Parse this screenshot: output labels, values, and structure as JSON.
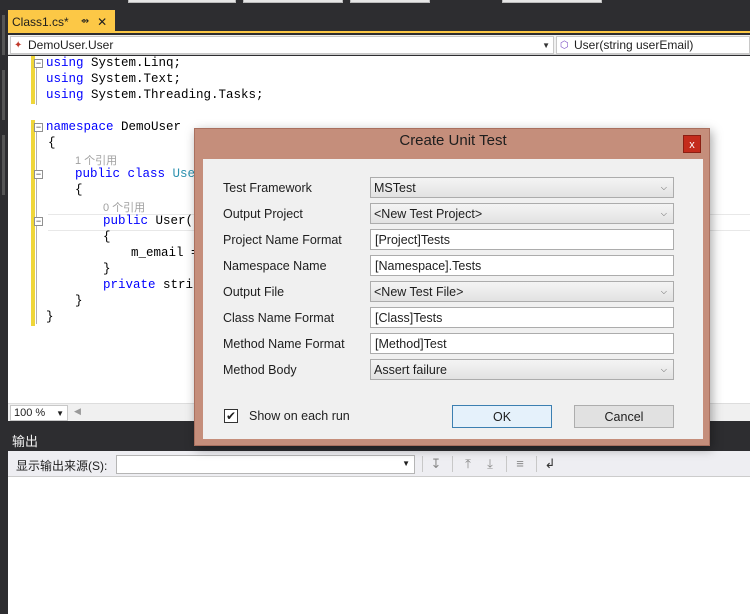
{
  "document_tab": {
    "title": "Class1.cs*",
    "pin_icon": "pin-icon",
    "close_icon": "close-icon"
  },
  "nav_bar": {
    "type_combo": "DemoUser.User",
    "member_combo": "User(string userEmail)"
  },
  "code": {
    "l1_kw": "using",
    "l1_rest": " System.Linq;",
    "l2_kw": "using",
    "l2_rest": " System.Text;",
    "l3_kw": "using",
    "l3_rest": " System.Threading.Tasks;",
    "l5_kw": "namespace",
    "l5_rest": " DemoUser",
    "l6": "{",
    "lens1": "1 个引用",
    "l7_kw": "public class",
    "l7_type": "User",
    "l8": "{",
    "lens2": "0 个引用",
    "l9_kw": "public",
    "l9_rest": " User(s",
    "l10": "{",
    "l11": "m_email =",
    "l12": "}",
    "l13_kw": "private",
    "l13_rest": " strin",
    "l14": "}",
    "l15": "}"
  },
  "zoom": {
    "value": "100 %"
  },
  "output_pane": {
    "title": "输出",
    "source_label": "显示输出来源(S):",
    "source_value": ""
  },
  "dialog": {
    "title": "Create Unit Test",
    "close_label": "x",
    "fields": {
      "test_framework": {
        "label": "Test Framework",
        "value": "MSTest"
      },
      "output_project": {
        "label": "Output Project",
        "value": "<New Test Project>"
      },
      "project_name_format": {
        "label": "Project Name Format",
        "value": "[Project]Tests"
      },
      "namespace_name": {
        "label": "Namespace Name",
        "value": "[Namespace].Tests"
      },
      "output_file": {
        "label": "Output File",
        "value": "<New Test File>"
      },
      "class_name_format": {
        "label": "Class Name Format",
        "value": "[Class]Tests"
      },
      "method_name_format": {
        "label": "Method Name Format",
        "value": "[Method]Test"
      },
      "method_body": {
        "label": "Method Body",
        "value": "Assert failure"
      }
    },
    "show_each_run": {
      "label": "Show on each run",
      "checked": true
    },
    "ok_label": "OK",
    "cancel_label": "Cancel",
    "colors": {
      "title_bar": "#c58e7b",
      "close_button": "#c42b1c"
    }
  },
  "colors": {
    "active_tab": "#fcc846",
    "ide_dark": "#2d2d30",
    "change_bar": "#efd63a"
  }
}
